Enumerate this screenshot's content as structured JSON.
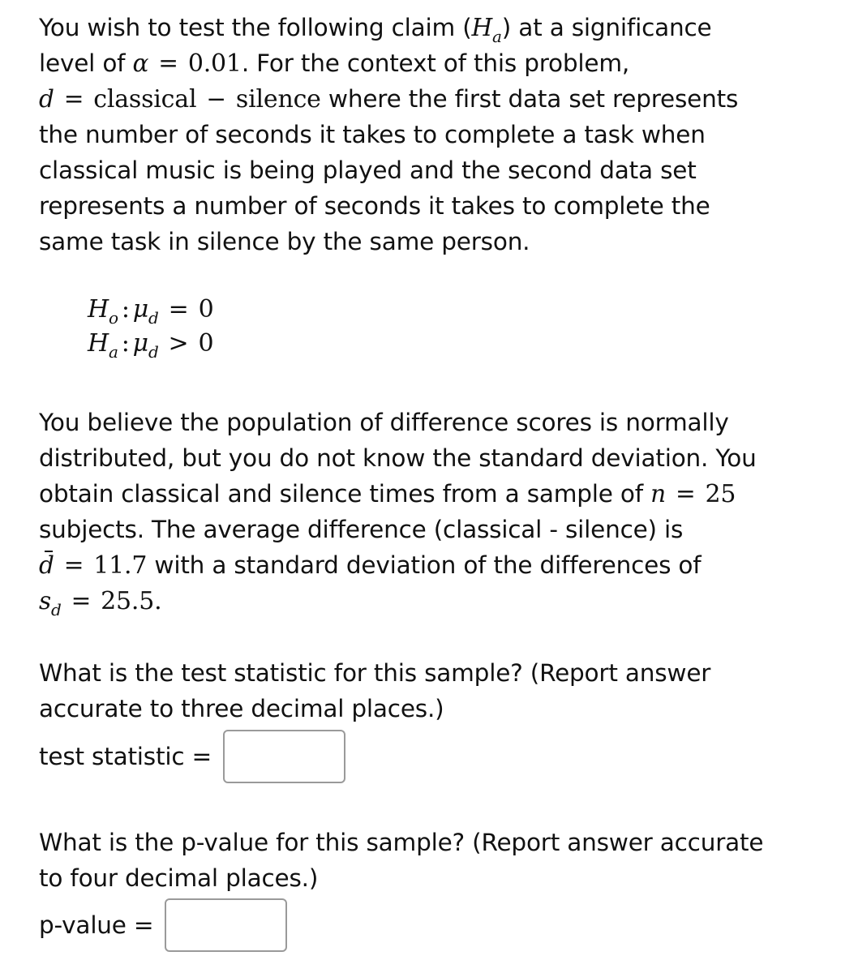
{
  "intro": {
    "line1": "You wish to test the following claim (",
    "line1_H": "H",
    "line1_sub": "a",
    "line1_end": ") at a significance",
    "line2_start": "level of ",
    "alpha_symbol": "α",
    "equals": "=",
    "alpha_value": "0.01",
    "line2_end": ". For the context of this problem,",
    "line3_d": "d",
    "line3_classical": "classical",
    "minus": "−",
    "line3_silence": "silence",
    "line3_end": " where the first data set represents",
    "line4": "the number of seconds it takes to complete a task when",
    "line5": "classical music is being played and the second data set",
    "line6": "represents a number of seconds it takes to complete the",
    "line7": "same task in silence by the same person."
  },
  "hypotheses": {
    "null": {
      "H": "H",
      "sub": "o",
      "colon": ":",
      "mu": "μ",
      "mu_sub": "d",
      "op": "=",
      "value": "0"
    },
    "alt": {
      "H": "H",
      "sub": "a",
      "colon": ":",
      "mu": "μ",
      "mu_sub": "d",
      "op": ">",
      "value": "0"
    }
  },
  "context": {
    "line1": "You believe the population of difference scores is normally",
    "line2": "distributed, but you do not know the standard deviation. You",
    "line3_start": "obtain classical and silence times from a sample of ",
    "n_symbol": "n",
    "n_value": "25",
    "line4": "subjects. The average difference (classical - silence) is",
    "dbar_symbol": "d",
    "dbar_value": "11.7",
    "line5_end": " with a standard deviation of the differences of",
    "sd_symbol": "s",
    "sd_sub": "d",
    "sd_value": "25.5",
    "period": "."
  },
  "question1": {
    "line1": "What is the test statistic for this sample? (Report answer",
    "line2": "accurate to three decimal places.)",
    "label": "test statistic =",
    "value": ""
  },
  "question2": {
    "line1": "What is the p-value for this sample? (Report answer accurate",
    "line2": "to four decimal places.)",
    "label": "p-value =",
    "value": ""
  }
}
